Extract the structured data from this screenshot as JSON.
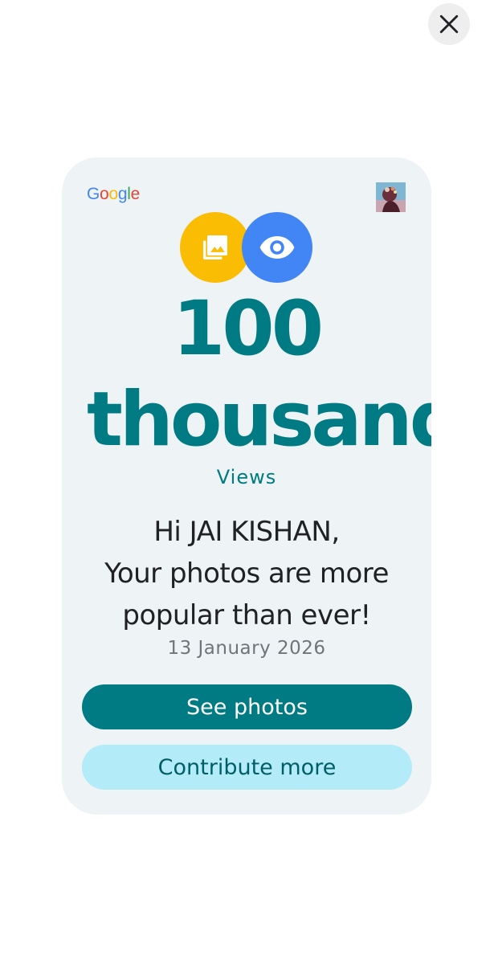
{
  "close_button": {
    "icon": "close-icon"
  },
  "card": {
    "brand": {
      "letters": [
        {
          "char": "G",
          "color": "#4285F4"
        },
        {
          "char": "o",
          "color": "#EA4335"
        },
        {
          "char": "o",
          "color": "#FBBC05"
        },
        {
          "char": "g",
          "color": "#4285F4"
        },
        {
          "char": "l",
          "color": "#34A853"
        },
        {
          "char": "e",
          "color": "#EA4335"
        }
      ]
    },
    "icons": {
      "photos": {
        "icon": "photo-library-icon",
        "color": "#fbbc04"
      },
      "views": {
        "icon": "eye-icon",
        "color": "#4285f4"
      }
    },
    "stat": {
      "number": "100",
      "unit": "thousand+",
      "label": "Views"
    },
    "message": {
      "line1": "Hi JAI KISHAN,",
      "line2": "Your photos are more",
      "line3": "popular than ever!"
    },
    "date": "13 January 2026",
    "buttons": {
      "primary": "See photos",
      "secondary": "Contribute more"
    },
    "colors": {
      "accent": "#007b83",
      "card_bg": "#eef3f5",
      "secondary_bg": "#b3ebf8"
    }
  }
}
